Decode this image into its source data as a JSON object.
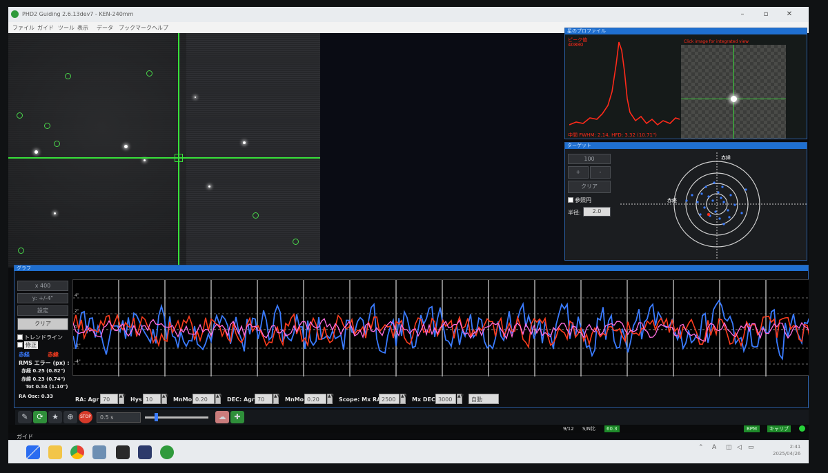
{
  "window": {
    "title": "PHD2 Guiding 2.6.13dev7 - KEN-240mm",
    "minimize": "–",
    "maximize": "▫",
    "close": "✕"
  },
  "menu": [
    "ファイル",
    "ガイド",
    "ツール",
    "表示",
    "データ",
    "ブックマーク",
    "ヘルプ"
  ],
  "profile": {
    "header": "星のプロファイル",
    "peak_label": "ピーク値",
    "peak_value": "40880",
    "hint": "Click image for integrated view",
    "stats": "中間 FWHM: 2.14, HFD: 3.32 (10.71\")"
  },
  "target": {
    "header": "ターゲット",
    "scale_value": "100",
    "plus": "+",
    "minus": "-",
    "clear": "クリア",
    "ref_circle": "参照円",
    "radius_label": "半径:",
    "radius_value": "2.0",
    "axis_top": "赤緯",
    "axis_left": "赤経"
  },
  "graph": {
    "header": "グラフ",
    "scale": "x 400",
    "units": "y: +/-4\"",
    "settings": "設定",
    "clear": "クリア",
    "trendline": "トレンドライン",
    "correction": "修正",
    "legend_ra": "赤経",
    "legend_dec": "赤緯",
    "rms_title": "RMS エラー (px) :",
    "rms_ra": "赤経 0.25 (0.82\")",
    "rms_dec": "赤緯 0.23 (0.74\")",
    "rms_tot": "Tot 0.34 (1.10\")",
    "ra_osc": "RA Osc: 0.33",
    "y_ticks": [
      "4\"",
      "2\"",
      "0",
      "-2\"",
      "-4\""
    ],
    "params": {
      "ra_agr_label": "RA: Agr",
      "ra_agr": "70",
      "hys_label": "Hys",
      "hys": "10",
      "mnmo_label": "MnMo",
      "mnmo": "0.20",
      "dec_agr_label": "DEC: Agr",
      "dec_agr": "70",
      "dec_mnmo_label": "MnMo",
      "dec_mnmo": "0.20",
      "scope_label": "Scope: Mx RA",
      "mx_ra": "2500",
      "mx_dec_label": "Mx DEC",
      "mx_dec": "3000",
      "mode": "自動"
    },
    "colors": {
      "ra": "#3a7bff",
      "dec": "#ff3d1f",
      "corr": "#ff6fe0"
    }
  },
  "toolbar": {
    "exposure": "0.5 s"
  },
  "status": {
    "frames": "9/12",
    "snr_label": "S/N比",
    "snr": "60.3",
    "bpm": "BPM",
    "cal": "キャリブ"
  },
  "statusline": "ガイド",
  "taskbar": {
    "clock_time": "2:41",
    "clock_date": "2025/04/26"
  }
}
